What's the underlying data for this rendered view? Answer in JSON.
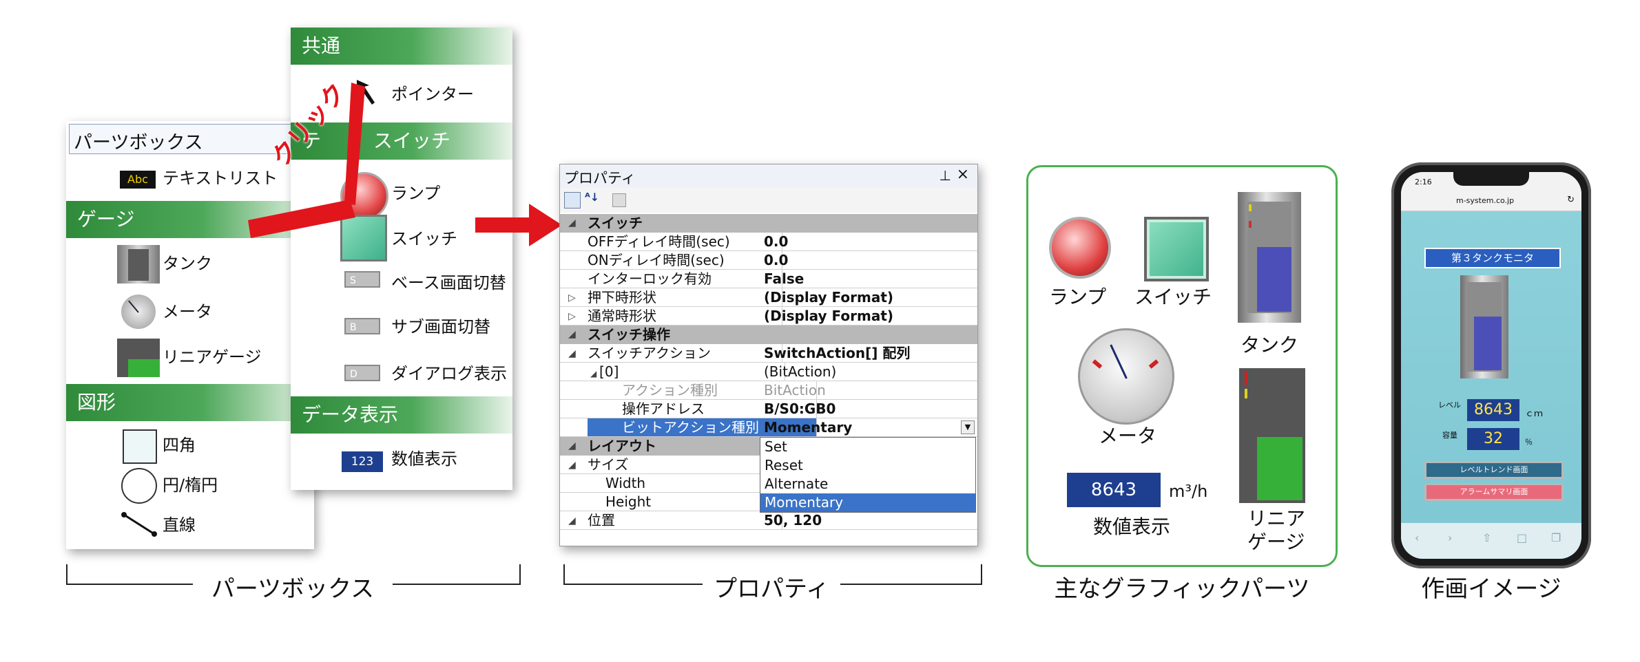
{
  "partsbox": {
    "title": "パーツボックス",
    "items_top": [
      "テキストリスト"
    ],
    "groups": {
      "gauge": {
        "label": "ゲージ",
        "items": [
          "タンク",
          "メータ",
          "リニアゲージ"
        ]
      },
      "shape": {
        "label": "図形",
        "items": [
          "四角",
          "円/楕円",
          "直線"
        ]
      }
    },
    "abc_icon_text": "Abc",
    "popup": {
      "common_label": "共通",
      "pointer_label": "ポインター",
      "partial_header_left": "テ",
      "switch_group_label": "スイッチ",
      "items": [
        "ランプ",
        "スイッチ",
        "ベース画面切替",
        "サブ画面切替",
        "ダイアログ表示"
      ],
      "data_group_label": "データ表示",
      "numeric_label": "数値表示",
      "numeric_icon_text": "123",
      "btn_letters": [
        "S",
        "B",
        "D"
      ]
    },
    "click_label": "クリック"
  },
  "properties": {
    "title": "プロパティ",
    "pin": "ᵖ",
    "close": "×",
    "cat_switch": "スイッチ",
    "rows1": [
      {
        "k": "OFFディレイ時間(sec)",
        "v": "0.0"
      },
      {
        "k": "ONディレイ時間(sec)",
        "v": "0.0"
      },
      {
        "k": "インターロック有効",
        "v": "False"
      },
      {
        "k": "押下時形状",
        "v": "(Display Format)"
      },
      {
        "k": "通常時形状",
        "v": "(Display Format)"
      }
    ],
    "cat_op": "スイッチ操作",
    "action_k": "スイッチアクション",
    "action_v": "SwitchAction[] 配列",
    "idx_k": "[0]",
    "idx_v": "(BitAction)",
    "type_k": "アクション種別",
    "type_v": "BitAction",
    "addr_k": "操作アドレス",
    "addr_v": "B/S0:GB0",
    "bit_k": "ビットアクション種別",
    "bit_v": "Momentary",
    "cat_layout": "レイアウト",
    "size_k": "サイズ",
    "width_k": "Width",
    "height_k": "Height",
    "pos_k": "位置",
    "pos_v": "50, 120",
    "options": [
      "Set",
      "Reset",
      "Alternate",
      "Momentary"
    ]
  },
  "graphics": {
    "lamp": "ランプ",
    "switch": "スイッチ",
    "tank": "タンク",
    "meter": "メータ",
    "numeric_value": "8643",
    "numeric_unit": "m³/h",
    "numeric_label": "数値表示",
    "linear_label_1": "リニア",
    "linear_label_2": "ゲージ"
  },
  "phone": {
    "time": "2:16",
    "url": "m-system.co.jp",
    "title": "第３タンクモニタ",
    "level_label": "レベル",
    "level_value": "8643",
    "level_unit": "ｃｍ",
    "cap_label": "容量",
    "cap_value": "32",
    "cap_unit": "％",
    "btn_trend": "レベルトレンド画面",
    "btn_alarm": "アラームサマリ画面"
  },
  "captions": {
    "partsbox": "パーツボックス",
    "properties": "プロパティ",
    "graphics": "主なグラフィックパーツ",
    "image": "作画イメージ"
  },
  "colors": {
    "green": "#2f8a3a",
    "red_arrow": "#e0161c",
    "frame_green": "#4bb050",
    "lcd_blue": "#1e3f8f"
  }
}
